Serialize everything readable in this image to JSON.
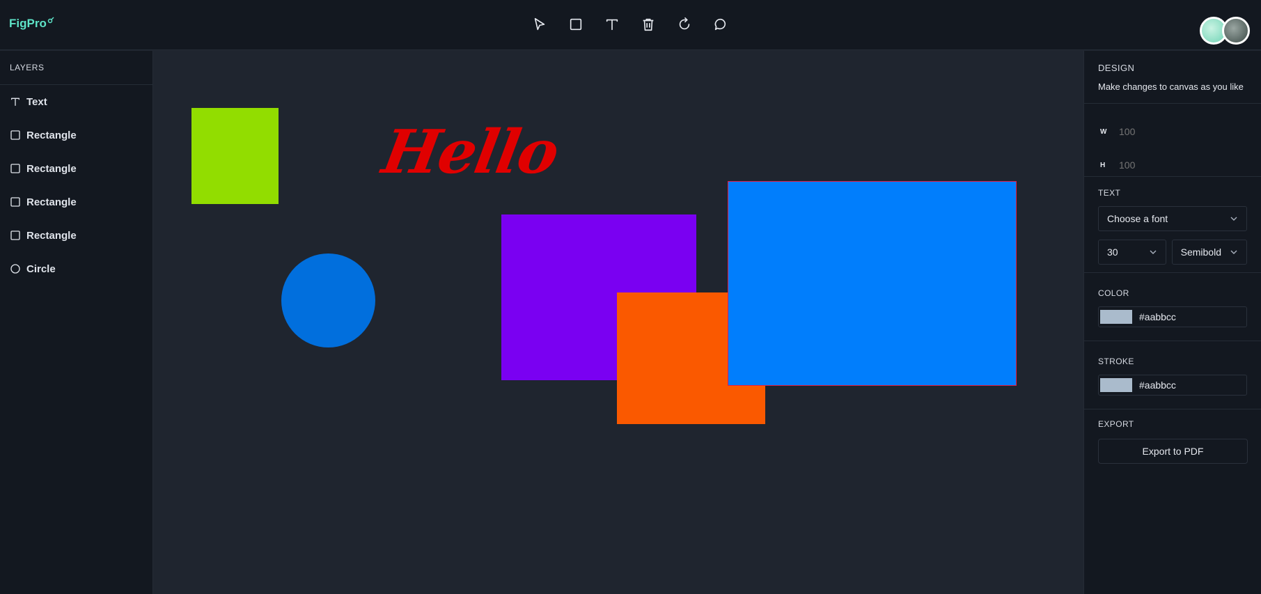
{
  "app": {
    "logo": "FigPro",
    "logo_mark": "⚲"
  },
  "toolbar": {
    "tools": [
      {
        "name": "select",
        "icon": "cursor-arrow-icon"
      },
      {
        "name": "rectangle",
        "icon": "square-icon"
      },
      {
        "name": "text",
        "icon": "text-icon"
      },
      {
        "name": "delete",
        "icon": "trash-icon"
      },
      {
        "name": "reset",
        "icon": "refresh-icon"
      },
      {
        "name": "comments",
        "icon": "comment-icon"
      }
    ]
  },
  "layers": {
    "title": "LAYERS",
    "items": [
      {
        "label": "Text",
        "icon": "text-icon"
      },
      {
        "label": "Rectangle",
        "icon": "square-icon"
      },
      {
        "label": "Rectangle",
        "icon": "square-icon"
      },
      {
        "label": "Rectangle",
        "icon": "square-icon"
      },
      {
        "label": "Rectangle",
        "icon": "square-icon"
      },
      {
        "label": "Circle",
        "icon": "circle-icon"
      }
    ]
  },
  "canvas": {
    "text_object": {
      "text": "Hello",
      "color": "#e00000"
    },
    "colors": {
      "green_rect": "#92dd00",
      "circle": "#016fdd",
      "purple_rect": "#7a00f2",
      "orange_rect": "#fa5900",
      "blue_rect": "#017efc"
    }
  },
  "design": {
    "title": "DESIGN",
    "subtitle": "Make changes to canvas as you like",
    "width_label": "W",
    "width_placeholder": "100",
    "height_label": "H",
    "height_placeholder": "100",
    "text_title": "TEXT",
    "font_family": "Choose a font",
    "font_size": "30",
    "font_weight": "Semibold",
    "color_title": "COLOR",
    "color_value": "#aabbcc",
    "stroke_title": "STROKE",
    "stroke_value": "#aabbcc",
    "export_title": "EXPORT",
    "export_button": "Export to PDF"
  }
}
